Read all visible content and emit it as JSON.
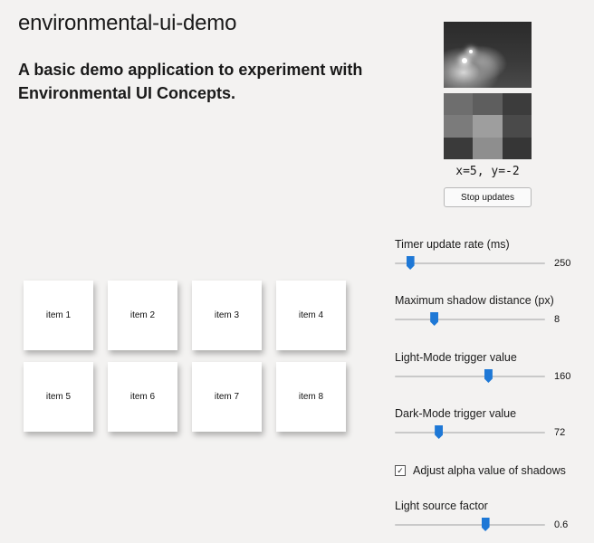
{
  "app": {
    "title": "environmental-ui-demo",
    "subtitle": "A basic demo application to experiment with Environmental UI Concepts."
  },
  "camera": {
    "coords_text": "x=5,  y=-2",
    "stop_button_label": "Stop updates",
    "grid_shades": [
      "#6e6e6e",
      "#5e5e5e",
      "#3c3c3c",
      "#7b7b7b",
      "#9e9e9e",
      "#4a4a4a",
      "#3a3a3a",
      "#8e8e8e",
      "#363636"
    ]
  },
  "items": [
    "item 1",
    "item 2",
    "item 3",
    "item 4",
    "item 5",
    "item 6",
    "item 7",
    "item 8"
  ],
  "controls": {
    "accent_color": "#1e78d6",
    "sliders": [
      {
        "label": "Timer update rate (ms)",
        "value": "250",
        "fraction": 0.1
      },
      {
        "label": "Maximum shadow distance (px)",
        "value": "8",
        "fraction": 0.26
      },
      {
        "label": "Light-Mode trigger value",
        "value": "160",
        "fraction": 0.62
      },
      {
        "label": "Dark-Mode trigger value",
        "value": "72",
        "fraction": 0.29
      }
    ],
    "checkbox": {
      "label": "Adjust alpha value of shadows",
      "checked": true,
      "check_glyph": "✓"
    },
    "light_source": {
      "label": "Light source factor",
      "value": "0.6",
      "fraction": 0.6
    }
  }
}
